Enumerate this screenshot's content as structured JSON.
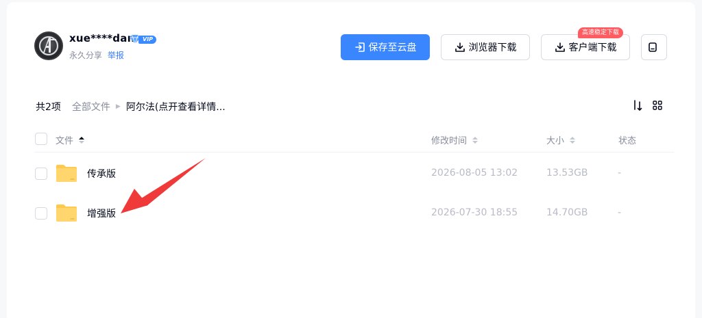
{
  "user": {
    "name": "xue****dan",
    "vip_label": "VIP",
    "permanent_share": "永久分享",
    "report": "举报"
  },
  "actions": {
    "save_to_cloud": "保存至云盘",
    "browser_download": "浏览器下载",
    "client_download": "客户端下载",
    "client_badge": "高速稳定下载"
  },
  "breadcrumb": {
    "count": "共2项",
    "all_files": "全部文件",
    "current": "阿尔法(点开查看详情..."
  },
  "table": {
    "headers": {
      "name": "文件",
      "modified": "修改时间",
      "size": "大小",
      "status": "状态"
    },
    "rows": [
      {
        "name": "传承版",
        "modified": "2026-08-05 13:02",
        "size": "13.53GB",
        "status": "-"
      },
      {
        "name": "增强版",
        "modified": "2026-07-30 18:55",
        "size": "14.70GB",
        "status": "-"
      }
    ]
  },
  "colors": {
    "primary": "#3a86ff",
    "badge": "#ff5b61",
    "folder": "#ffd66e",
    "annotation_arrow": "#f03a3a"
  },
  "icons": {
    "avatar": "avengers-logo",
    "vip": "diamond-icon",
    "save": "save-to-cloud-icon",
    "download": "download-icon",
    "square": "qr-device-icon",
    "sort": "sort-icon",
    "grid": "grid-view-icon",
    "folder": "folder-icon"
  }
}
